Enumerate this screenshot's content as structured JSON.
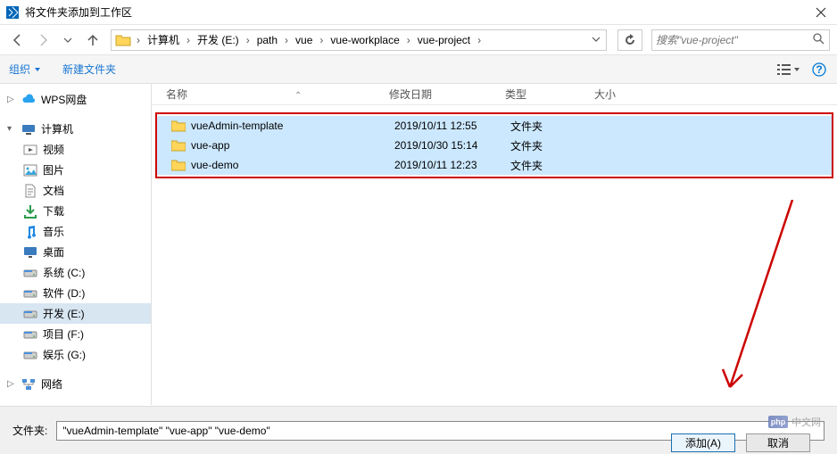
{
  "titlebar": {
    "title": "将文件夹添加到工作区"
  },
  "nav": {
    "back": "←",
    "forward": "→",
    "up": "↑"
  },
  "breadcrumb": {
    "items": [
      "计算机",
      "开发 (E:)",
      "path",
      "vue",
      "vue-workplace",
      "vue-project"
    ]
  },
  "search": {
    "placeholder": "搜索\"vue-project\""
  },
  "toolbar": {
    "organize": "组织",
    "newfolder": "新建文件夹"
  },
  "sidebar": {
    "wps": "WPS网盘",
    "computer": "计算机",
    "children": [
      {
        "label": "视频",
        "icon": "video"
      },
      {
        "label": "图片",
        "icon": "picture"
      },
      {
        "label": "文档",
        "icon": "document"
      },
      {
        "label": "下载",
        "icon": "download"
      },
      {
        "label": "音乐",
        "icon": "music"
      },
      {
        "label": "桌面",
        "icon": "desktop"
      },
      {
        "label": "系统 (C:)",
        "icon": "drive"
      },
      {
        "label": "软件 (D:)",
        "icon": "drive"
      },
      {
        "label": "开发 (E:)",
        "icon": "drive",
        "active": true
      },
      {
        "label": "项目 (F:)",
        "icon": "drive"
      },
      {
        "label": "娱乐 (G:)",
        "icon": "drive"
      }
    ],
    "network": "网络"
  },
  "filelist": {
    "headers": {
      "name": "名称",
      "date": "修改日期",
      "type": "类型",
      "size": "大小"
    },
    "rows": [
      {
        "name": "vueAdmin-template",
        "date": "2019/10/11 12:55",
        "type": "文件夹"
      },
      {
        "name": "vue-app",
        "date": "2019/10/30 15:14",
        "type": "文件夹"
      },
      {
        "name": "vue-demo",
        "date": "2019/10/11 12:23",
        "type": "文件夹"
      }
    ]
  },
  "footer": {
    "label": "文件夹:",
    "value": "\"vueAdmin-template\" \"vue-app\" \"vue-demo\"",
    "add": "添加(A)",
    "cancel": "取消"
  },
  "watermark": {
    "logo": "php",
    "text": "中文网"
  }
}
